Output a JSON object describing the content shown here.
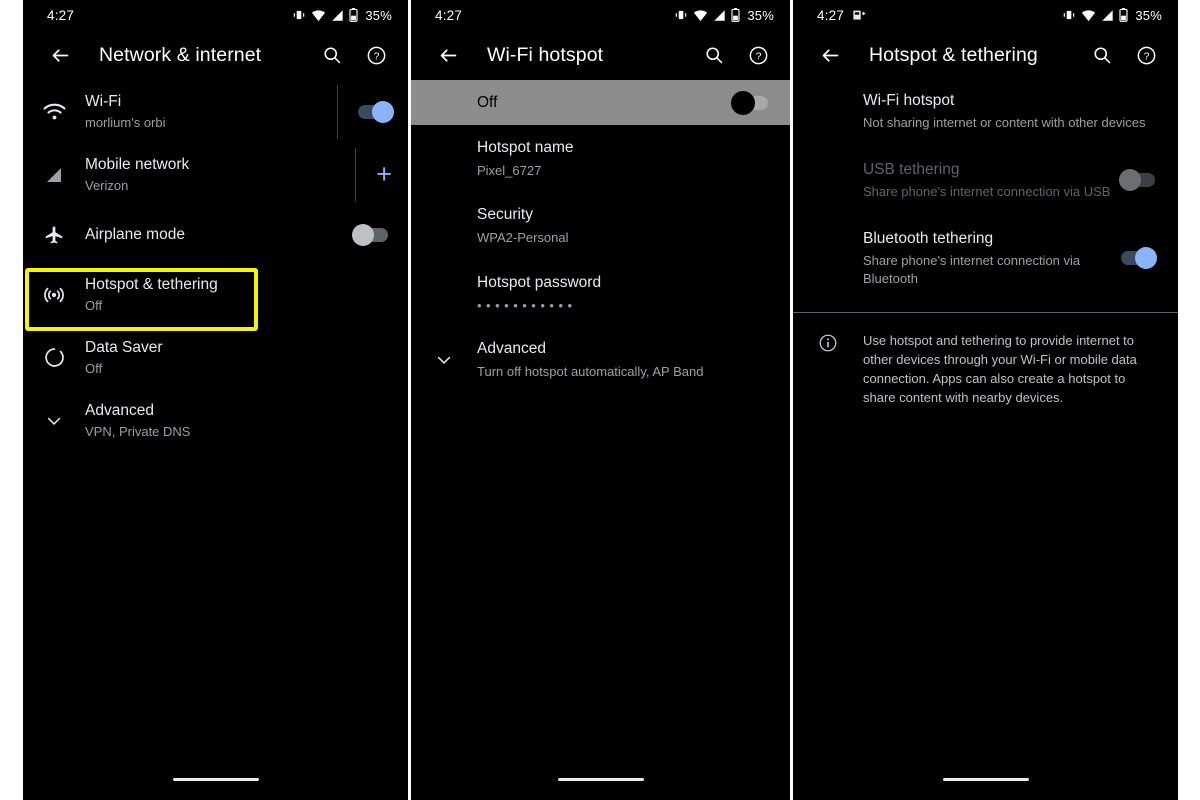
{
  "statusbar": {
    "time": "4:27",
    "battery_pct": "35%",
    "icons": [
      "vibrate-icon",
      "wifi-icon",
      "cellular-signal-icon",
      "battery-icon"
    ],
    "panel3_extra_icon": "screenshot-notification-icon"
  },
  "colors": {
    "accent": "#8ab4f8",
    "highlight": "#f5f500",
    "background": "#000000",
    "primary_text": "#e8eaed",
    "secondary_text": "#9aa0a6",
    "disabled_text": "#5f6368"
  },
  "panel1": {
    "appbar": {
      "title": "Network & internet",
      "back_icon": "back-arrow-icon",
      "search_icon": "search-icon",
      "help_icon": "help-icon"
    },
    "rows": [
      {
        "icon": "wifi-icon",
        "title": "Wi-Fi",
        "subtitle": "morlium's orbi",
        "trailing": "toggle-on"
      },
      {
        "icon": "cellular-signal-icon",
        "title": "Mobile network",
        "subtitle": "Verizon",
        "trailing": "plus"
      },
      {
        "icon": "airplane-icon",
        "title": "Airplane mode",
        "subtitle": "",
        "trailing": "toggle-off"
      },
      {
        "icon": "hotspot-icon",
        "title": "Hotspot & tethering",
        "subtitle": "Off",
        "trailing": "none"
      },
      {
        "icon": "data-saver-icon",
        "title": "Data Saver",
        "subtitle": "Off",
        "trailing": "none"
      },
      {
        "icon": "chevron-down-icon",
        "title": "Advanced",
        "subtitle": "VPN, Private DNS",
        "trailing": "none"
      }
    ],
    "highlight_target": "Hotspot & tethering"
  },
  "panel2": {
    "appbar": {
      "title": "Wi-Fi hotspot",
      "back_icon": "back-arrow-icon",
      "search_icon": "search-icon",
      "help_icon": "help-icon"
    },
    "master_switch": {
      "label": "Off",
      "state": "off"
    },
    "rows": [
      {
        "title": "Hotspot name",
        "subtitle": "Pixel_6727",
        "icon": ""
      },
      {
        "title": "Security",
        "subtitle": "WPA2-Personal",
        "icon": ""
      },
      {
        "title": "Hotspot password",
        "subtitle": "•••••••••••",
        "icon": ""
      },
      {
        "title": "Advanced",
        "subtitle": "Turn off hotspot automatically, AP Band",
        "icon": "chevron-down-icon"
      }
    ]
  },
  "panel3": {
    "appbar": {
      "title": "Hotspot & tethering",
      "back_icon": "back-arrow-icon",
      "search_icon": "search-icon",
      "help_icon": "help-icon"
    },
    "rows": [
      {
        "title": "Wi-Fi hotspot",
        "subtitle": "Not sharing internet or content with other devices",
        "trailing": "none",
        "disabled": false
      },
      {
        "title": "USB tethering",
        "subtitle": "Share phone's internet connection via USB",
        "trailing": "toggle-off",
        "disabled": true
      },
      {
        "title": "Bluetooth tethering",
        "subtitle": "Share phone's internet connection via Bluetooth",
        "trailing": "toggle-on",
        "disabled": false
      }
    ],
    "footnote": {
      "icon": "info-icon",
      "text": "Use hotspot and tethering to provide internet to other devices through your Wi-Fi or mobile data connection. Apps can also create a hotspot to share content with nearby devices."
    }
  }
}
